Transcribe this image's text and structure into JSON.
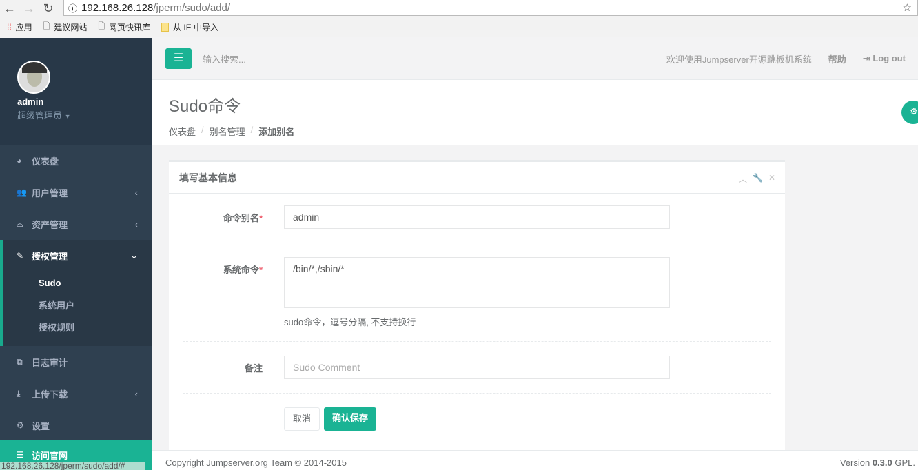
{
  "browser": {
    "url_host": "192.168.26.128",
    "url_path": "/jperm/sudo/add/",
    "bookmarks": [
      "应用",
      "建议网站",
      "网页快讯库",
      "从 IE 中导入"
    ],
    "status_url": "192.168.26.128/jperm/sudo/add/#"
  },
  "profile": {
    "name": "admin",
    "role": "超级管理员"
  },
  "sidebar": {
    "items": [
      {
        "label": "仪表盘",
        "icon": "dashboard-icon"
      },
      {
        "label": "用户管理",
        "icon": "users-icon"
      },
      {
        "label": "资产管理",
        "icon": "inbox-icon"
      },
      {
        "label": "授权管理",
        "icon": "edit-icon"
      },
      {
        "label": "日志审计",
        "icon": "files-icon"
      },
      {
        "label": "上传下载",
        "icon": "download-icon"
      },
      {
        "label": "设置",
        "icon": "cogs-icon"
      },
      {
        "label": "访问官网",
        "icon": "database-icon"
      }
    ],
    "sub": [
      "Sudo",
      "系统用户",
      "授权规则"
    ]
  },
  "topbar": {
    "search_placeholder": "输入搜索...",
    "welcome": "欢迎使用Jumpserver开源跳板机系统",
    "help": "帮助",
    "logout": "Log out"
  },
  "heading": {
    "title": "Sudo命令",
    "breadcrumb": [
      "仪表盘",
      "别名管理",
      "添加别名"
    ]
  },
  "form": {
    "title": "填写基本信息",
    "alias_label": "命令别名",
    "alias_value": "admin",
    "cmd_label": "系统命令",
    "cmd_value": "/bin/*,/sbin/*",
    "cmd_help": "sudo命令，逗号分隔, 不支持换行",
    "comment_label": "备注",
    "comment_placeholder": "Sudo Comment",
    "cancel": "取消",
    "save": "确认保存"
  },
  "footer": {
    "copyright": "Copyright Jumpserver.org Team © 2014-2015",
    "version_prefix": "Version",
    "version": "0.3.0",
    "version_suffix": "GPL."
  },
  "colors": {
    "accent": "#1ab394",
    "sidebar": "#2f4050"
  }
}
